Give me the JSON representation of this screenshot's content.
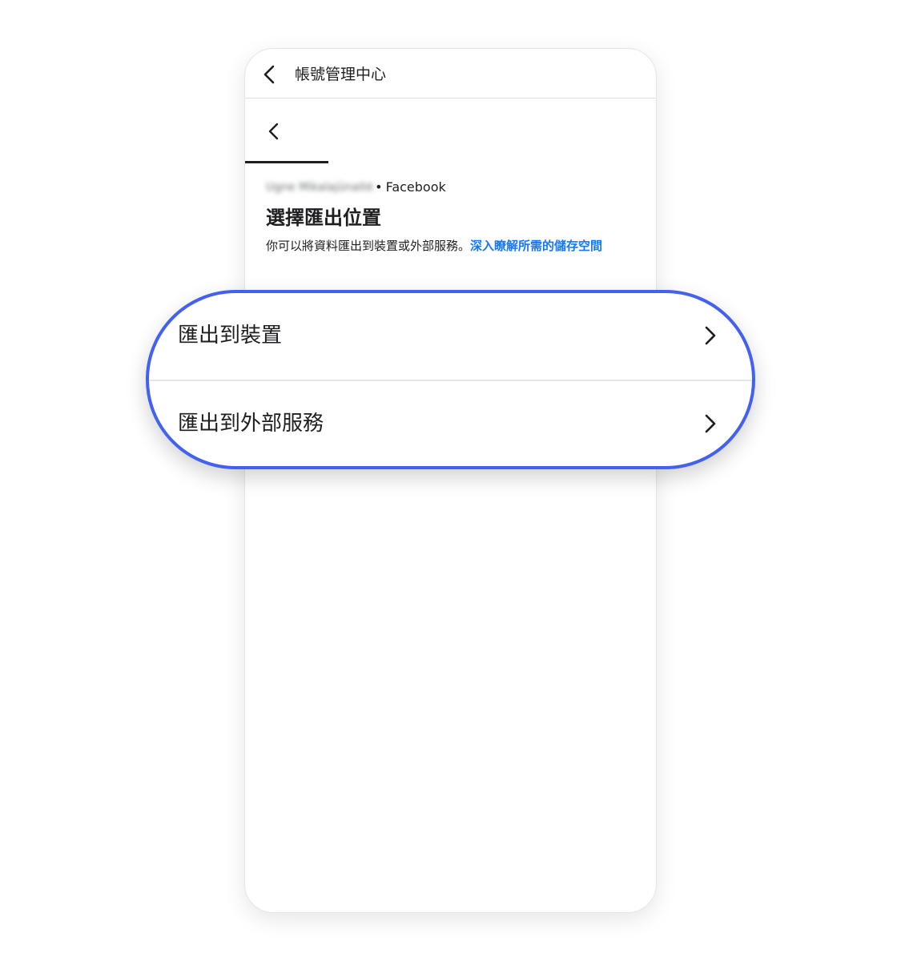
{
  "header": {
    "title": "帳號管理中心",
    "back_icon": "chevron-left-icon"
  },
  "subnav": {
    "back_icon": "chevron-left-icon"
  },
  "account": {
    "name": "Ugne Mikalajūnaitė",
    "separator": "•",
    "platform": "Facebook"
  },
  "page": {
    "title": "選擇匯出位置",
    "description": "你可以將資料匯出到裝置或外部服務。",
    "link_text": "深入瞭解所需的儲存空間"
  },
  "options": [
    {
      "label": "匯出到裝置",
      "icon": "chevron-right-icon"
    },
    {
      "label": "匯出到外部服務",
      "icon": "chevron-right-icon"
    }
  ],
  "colors": {
    "highlight_border": "#4261f0",
    "link": "#1877f2",
    "text": "#1c1e21"
  }
}
